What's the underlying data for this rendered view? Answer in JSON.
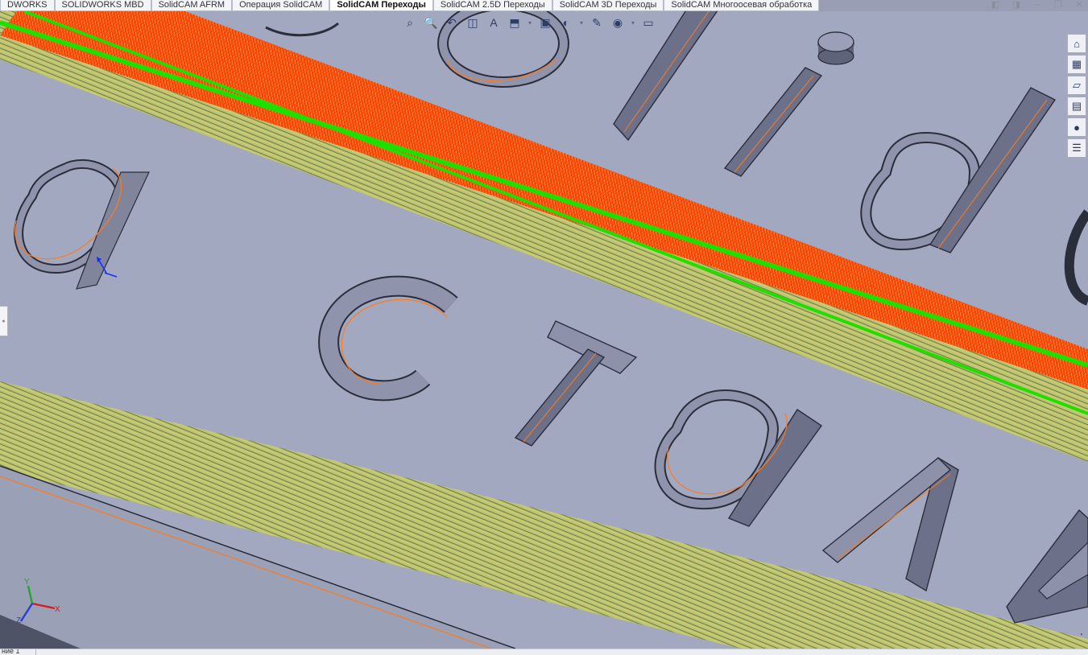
{
  "tabs": [
    {
      "label": "DWORKS",
      "active": false
    },
    {
      "label": "SOLIDWORKS MBD",
      "active": false
    },
    {
      "label": "SolidCAM AFRM",
      "active": false
    },
    {
      "label": "Операция  SolidCAM",
      "active": false
    },
    {
      "label": "SolidCAM Переходы",
      "active": true
    },
    {
      "label": "SolidCAM 2.5D Переходы",
      "active": false
    },
    {
      "label": "SolidCAM 3D Переходы",
      "active": false
    },
    {
      "label": "SolidCAM Многоосевая обработка",
      "active": false
    }
  ],
  "window_controls": [
    {
      "name": "prev-window-icon",
      "glyph": "◧"
    },
    {
      "name": "next-window-icon",
      "glyph": "◨"
    },
    {
      "name": "minimize-icon",
      "glyph": "–"
    },
    {
      "name": "restore-icon",
      "glyph": "❐"
    },
    {
      "name": "close-icon",
      "glyph": "✕"
    }
  ],
  "hud_toolbar": [
    {
      "name": "zoom-to-fit-icon",
      "glyph": "⌕"
    },
    {
      "name": "zoom-to-area-icon",
      "glyph": "🔍"
    },
    {
      "name": "previous-view-icon",
      "glyph": "↶"
    },
    {
      "name": "section-view-icon",
      "glyph": "◫"
    },
    {
      "name": "dynamic-annotation-icon",
      "glyph": "A"
    },
    {
      "name": "view-orientation-icon",
      "glyph": "⬒"
    },
    {
      "name": "display-style-icon",
      "glyph": "▣"
    },
    {
      "name": "hide-show-items-icon",
      "glyph": "◐"
    },
    {
      "name": "edit-appearance-icon",
      "glyph": "✎"
    },
    {
      "name": "apply-scene-icon",
      "glyph": "◉"
    },
    {
      "name": "view-settings-icon",
      "glyph": "▭"
    }
  ],
  "task_pane": [
    {
      "name": "home-icon",
      "glyph": "⌂"
    },
    {
      "name": "parts-library-icon",
      "glyph": "▦"
    },
    {
      "name": "file-explorer-icon",
      "glyph": "▱"
    },
    {
      "name": "view-palette-icon",
      "glyph": "▤"
    },
    {
      "name": "appearances-icon",
      "glyph": "●"
    },
    {
      "name": "custom-properties-icon",
      "glyph": "☰"
    }
  ],
  "status_bar": {
    "text": "ние 1"
  },
  "triad": {
    "x_label": "X",
    "y_label": "Y",
    "z_label": "Z"
  },
  "colors": {
    "viewport_bg": "#9a9eb5",
    "part_face": "#a2a7bf",
    "part_wall": "#5e6379",
    "toolpath_orange": "#ff5a00",
    "toolpath_green": "#22e000",
    "toolpath_olive": "#6e7f2a",
    "toolpath_edge": "#ff8c1a"
  }
}
